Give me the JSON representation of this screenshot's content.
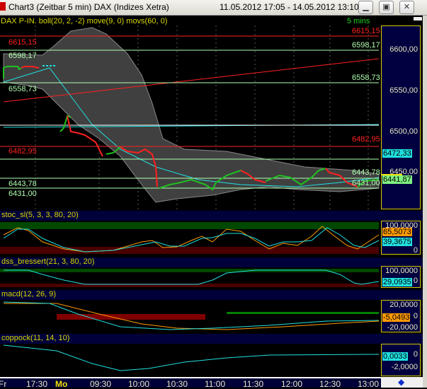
{
  "window": {
    "title": "Chart3 (Zeitbar 5 min)  DAX (Indizes Xetra)",
    "range": "11.05.2012 17:05 - 14.05.2012 13:10",
    "buttons": [
      "minimize",
      "maximize",
      "close"
    ]
  },
  "price_panel": {
    "header": "DAX P-IN. boll(20, 2, -2) move(9, 0) movs(60, 0)",
    "interval": "5 mins",
    "axis": [
      "6600,00",
      "6550,00",
      "6500,00",
      "6450,00"
    ],
    "levels": [
      {
        "label": "6615,15",
        "price": 6615.15,
        "color": "#ff2020"
      },
      {
        "label": "6598,17",
        "price": 6598.17,
        "color": "#b0ffb0"
      },
      {
        "label": "6558,73",
        "price": 6558.73,
        "color": "#b0ffb0"
      },
      {
        "label": "6482,95",
        "price": 6482.95,
        "color": "#ff2020"
      },
      {
        "label": "6443,78",
        "price": 6443.78,
        "color": "#b0ffb0"
      },
      {
        "label": "6431,00",
        "price": 6431.0,
        "color": "#b0ffb0"
      }
    ],
    "current_ma": "6472,33",
    "current_price": "6441,87"
  },
  "stoc": {
    "header": "stoc_sl(5, 3, 3, 80, 20)",
    "axis": [
      "100,0000",
      "0"
    ],
    "value1": "65,5073",
    "value2": "39,3675"
  },
  "dss": {
    "header": "dss_bressert(21, 3, 80, 20)",
    "axis": [
      "100,0000",
      "0"
    ],
    "value": "29,0935"
  },
  "macd": {
    "header": "macd(12, 26, 9)",
    "axis": [
      "20,0000",
      "0",
      "-20,0000"
    ],
    "value": "-5,0493"
  },
  "coppock": {
    "header": "coppock(11, 14, 10)",
    "axis": [
      "0",
      "-2,0000"
    ],
    "value": "0,0033"
  },
  "time_axis": [
    "Fr",
    "17:30",
    "Mo",
    "09:30",
    "10:00",
    "10:30",
    "11:00",
    "11:30",
    "12:00",
    "12:30",
    "13:00"
  ]
}
